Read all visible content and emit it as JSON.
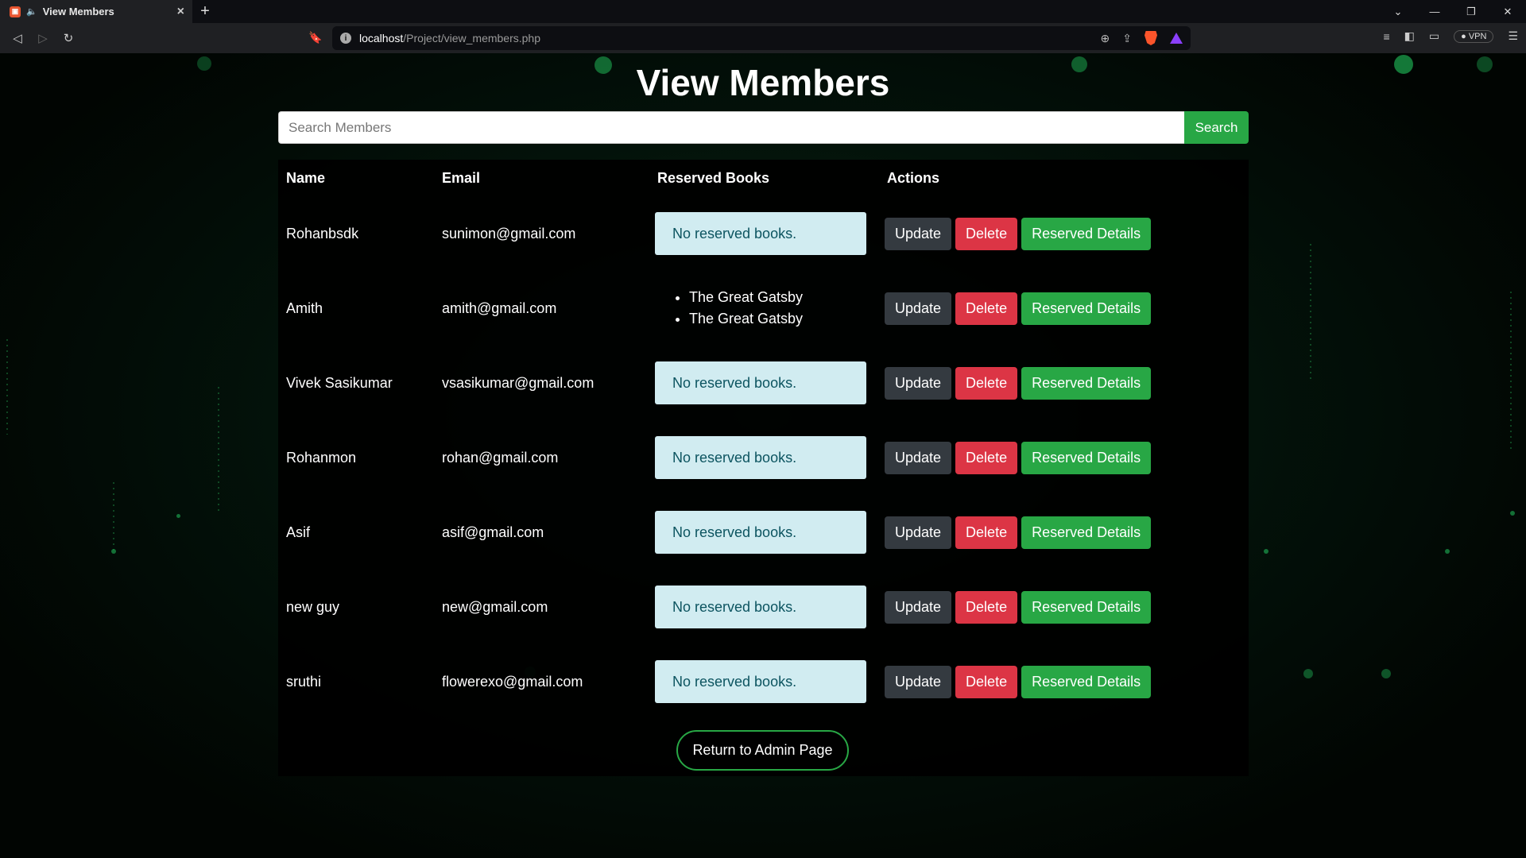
{
  "browser": {
    "tab_title": "View Members",
    "url_host": "localhost",
    "url_path": "/Project/view_members.php",
    "vpn_label": "VPN"
  },
  "page": {
    "title": "View Members",
    "search_placeholder": "Search Members",
    "search_button": "Search",
    "columns": [
      "Name",
      "Email",
      "Reserved Books",
      "Actions"
    ],
    "no_reserved_text": "No reserved books.",
    "action_labels": {
      "update": "Update",
      "delete": "Delete",
      "reserved": "Reserved Details"
    },
    "return_button": "Return to Admin Page"
  },
  "members": [
    {
      "name": "Rohanbsdk",
      "email": "sunimon@gmail.com",
      "books": []
    },
    {
      "name": "Amith",
      "email": "amith@gmail.com",
      "books": [
        "The Great Gatsby",
        "The Great Gatsby"
      ]
    },
    {
      "name": "Vivek Sasikumar",
      "email": "vsasikumar@gmail.com",
      "books": []
    },
    {
      "name": "Rohanmon",
      "email": "rohan@gmail.com",
      "books": []
    },
    {
      "name": "Asif",
      "email": "asif@gmail.com",
      "books": []
    },
    {
      "name": "new guy",
      "email": "new@gmail.com",
      "books": []
    },
    {
      "name": "sruthi",
      "email": "flowerexo@gmail.com",
      "books": []
    }
  ],
  "colors": {
    "success": "#28a745",
    "danger": "#dc3545",
    "dark": "#343a40",
    "info_bg": "#d1ecf1",
    "info_text": "#0c5460"
  }
}
